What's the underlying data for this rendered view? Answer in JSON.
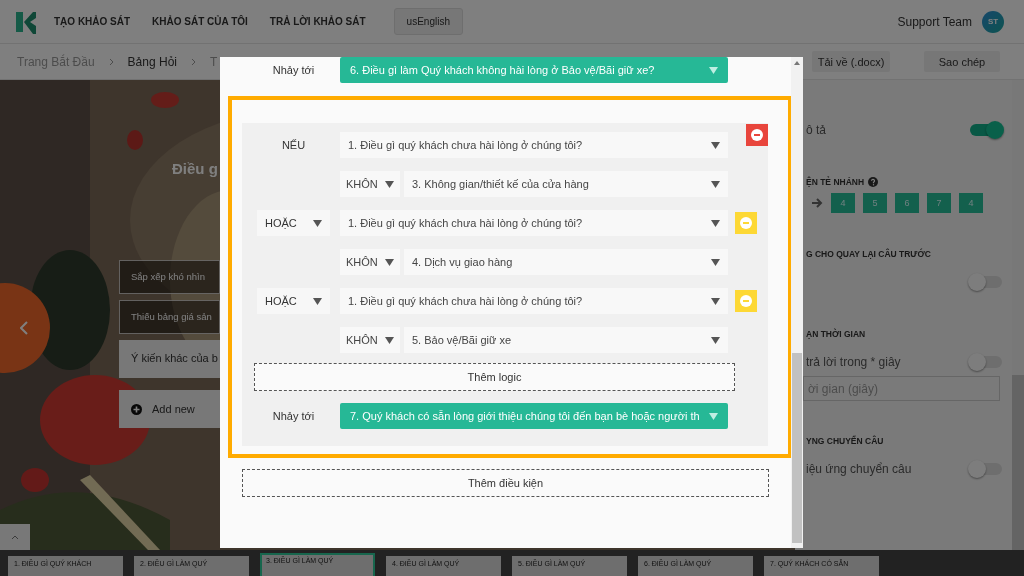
{
  "nav": {
    "menu": [
      "TẠO KHẢO SÁT",
      "KHẢO SÁT CỦA TÔI",
      "TRẢ LỜI KHẢO SÁT"
    ],
    "language": "usEnglish",
    "user": "Support Team",
    "avatar": "ST"
  },
  "breadcrumb": [
    {
      "label": "Trang Bắt Đầu",
      "current": false
    },
    {
      "label": "Bảng Hỏi",
      "current": true
    },
    {
      "label": "T",
      "current": false
    }
  ],
  "actions": [
    "Tải về (.docx)",
    "Sao chép"
  ],
  "question": {
    "title": "Điều g",
    "options": [
      "Sắp xếp khó nhìn",
      "Thiếu bảng giá sản"
    ],
    "other": "Ý kiến khác của b",
    "add": "Add new"
  },
  "settings": [
    {
      "kind": "toggle-row",
      "label": "ô tả",
      "on": true
    },
    {
      "kind": "heading-help",
      "label": "ỆN TẺ NHÁNH"
    },
    {
      "kind": "path",
      "steps": [
        "4",
        "5",
        "6",
        "7",
        "4"
      ]
    },
    {
      "kind": "heading",
      "label": "G CHO QUAY LẠI CÂU TRƯỚC"
    },
    {
      "kind": "toggle",
      "on": false
    },
    {
      "kind": "heading",
      "label": "ẠN THỜI GIAN"
    },
    {
      "kind": "toggle-row",
      "label": "trả lời trong * giây",
      "on": false
    },
    {
      "kind": "input",
      "placeholder": "ời gian (giây)"
    },
    {
      "kind": "heading",
      "label": "YNG CHUYỂN CÂU"
    },
    {
      "kind": "toggle-row",
      "label": "iệu ứng chuyển câu",
      "on": false
    }
  ],
  "thumbnails": [
    {
      "label": "1. ĐIỀU GÌ QUÝ KHÁCH",
      "selected": false
    },
    {
      "label": "2. ĐIỀU GÌ LÀM QUÝ",
      "selected": false
    },
    {
      "label": "3. ĐIỀU GÌ LÀM QUÝ",
      "selected": true
    },
    {
      "label": "4. ĐIỀU GÌ LÀM QUÝ",
      "selected": false
    },
    {
      "label": "5. ĐIỀU GÌ LÀM QUÝ",
      "selected": false
    },
    {
      "label": "6. ĐIỀU GÌ LÀM QUÝ",
      "selected": false
    },
    {
      "label": "7. QUÝ KHÁCH CÓ SẴN",
      "selected": false
    }
  ],
  "modal": {
    "top_jump": {
      "label": "Nhảy tới",
      "target": "6. Điều gì làm Quý khách không hài lòng ở Bảo vệ/Bãi giữ xe?"
    },
    "conditions": [
      {
        "kind": "label",
        "connector": "NẾU",
        "question": "1. Điều gì quý khách chưa hài lòng ở chúng tôi?",
        "operator": "KHÔN",
        "answer": "3. Không gian/thiết kế của cửa hàng",
        "color": "#e8453c"
      },
      {
        "kind": "dropdown",
        "connector": "HOẶC",
        "question": "1. Điều gì quý khách chưa hài lòng ở chúng tôi?",
        "operator": "KHÔN",
        "answer": "4. Dịch vụ giao hàng",
        "color": "#fdd835"
      },
      {
        "kind": "dropdown",
        "connector": "HOẶC",
        "question": "1. Điều gì quý khách chưa hài lòng ở chúng tôi?",
        "operator": "KHÔN",
        "answer": "5. Bảo vệ/Bãi giữ xe",
        "color": "#fdd835"
      }
    ],
    "add_logic": "Thêm logic",
    "jump": {
      "label": "Nhảy tới",
      "target": "7. Quý khách có sẵn lòng giới thiệu chúng tôi đến bạn bè hoặc người th"
    },
    "add_condition": "Thêm điều kiện"
  }
}
